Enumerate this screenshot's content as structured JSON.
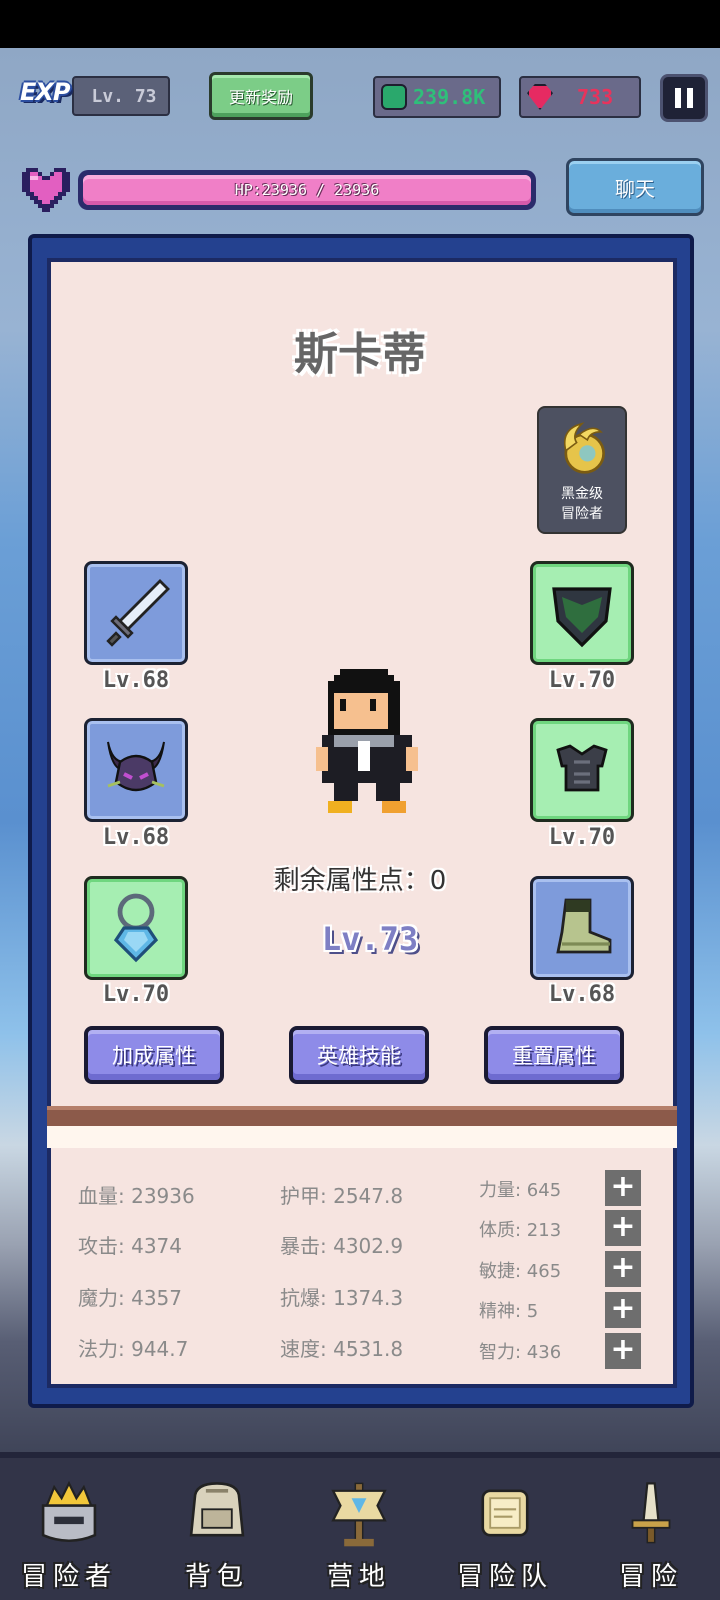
{
  "hud": {
    "exp_label": "EXP",
    "level": "Lv. 73",
    "reward_button": "更新奖励",
    "green_currency": "239.8K",
    "red_currency": "733",
    "hp_text": "HP:23936 / 23936",
    "hp_fraction": 1.0,
    "chat_button": "聊天"
  },
  "hero": {
    "name": "斯卡蒂",
    "rank_line1": "黑金级",
    "rank_line2": "冒险者",
    "remaining_points": "剩余属性点：0",
    "level": "Lv.73"
  },
  "equipment": [
    {
      "slot": "weapon",
      "level": "Lv.68",
      "rarity": "blue",
      "icon": "sword-icon"
    },
    {
      "slot": "helmet",
      "level": "Lv.68",
      "rarity": "blue",
      "icon": "horned-helmet-icon"
    },
    {
      "slot": "necklace",
      "level": "Lv.70",
      "rarity": "green",
      "icon": "necklace-icon"
    },
    {
      "slot": "shield",
      "level": "Lv.70",
      "rarity": "green",
      "icon": "shield-icon"
    },
    {
      "slot": "armor",
      "level": "Lv.70",
      "rarity": "green",
      "icon": "armor-icon"
    },
    {
      "slot": "boots",
      "level": "Lv.68",
      "rarity": "blue",
      "icon": "boot-icon"
    }
  ],
  "actions": {
    "bonus_attributes": "加成属性",
    "hero_skills": "英雄技能",
    "reset_attributes": "重置属性"
  },
  "stats": {
    "hp": "血量: 23936",
    "armor": "护甲: 2547.8",
    "attack": "攻击: 4374",
    "crit": "暴击: 4302.9",
    "magic": "魔力: 4357",
    "crit_resist": "抗爆: 1374.3",
    "mana": "法力: 944.7",
    "speed": "速度: 4531.8"
  },
  "attributes": [
    {
      "label": "力量: 645"
    },
    {
      "label": "体质: 213"
    },
    {
      "label": "敏捷: 465"
    },
    {
      "label": "精神: 5"
    },
    {
      "label": "智力: 436"
    }
  ],
  "plus_label": "+",
  "nav": [
    {
      "label": "冒险者",
      "icon": "crown-helmet-icon"
    },
    {
      "label": "背包",
      "icon": "backpack-icon"
    },
    {
      "label": "营地",
      "icon": "banner-icon"
    },
    {
      "label": "冒险队",
      "icon": "scroll-icon"
    },
    {
      "label": "冒险",
      "icon": "dagger-icon"
    }
  ],
  "colors": {
    "panel_blue": "#24418f",
    "panel_cream": "#f6e4e0",
    "rare_blue": "#7e9bdb",
    "uncommon_green": "#a6eeb2",
    "button_purple": "#8e8be8",
    "hp_pink": "#f07fc7"
  }
}
